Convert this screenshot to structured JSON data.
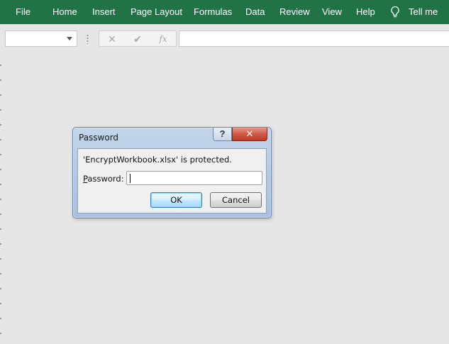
{
  "ribbon": {
    "tabs": [
      "File",
      "Home",
      "Insert",
      "Page Layout",
      "Formulas",
      "Data",
      "Review",
      "View",
      "Help"
    ],
    "tell_me_icon": "lightbulb-icon",
    "tell_me_label": "Tell me",
    "accent_color": "#217346"
  },
  "formula_bar": {
    "name_box_value": "",
    "cancel_icon": "✕",
    "enter_icon": "✔",
    "function_icon": "fx",
    "formula_value": ""
  },
  "dialog": {
    "title": "Password",
    "help_label": "?",
    "close_label": "✕",
    "message": "'EncryptWorkbook.xlsx' is protected.",
    "password_label_mnemonic": "P",
    "password_label_rest": "assword:",
    "password_value": "",
    "ok_label": "OK",
    "cancel_label": "Cancel"
  }
}
